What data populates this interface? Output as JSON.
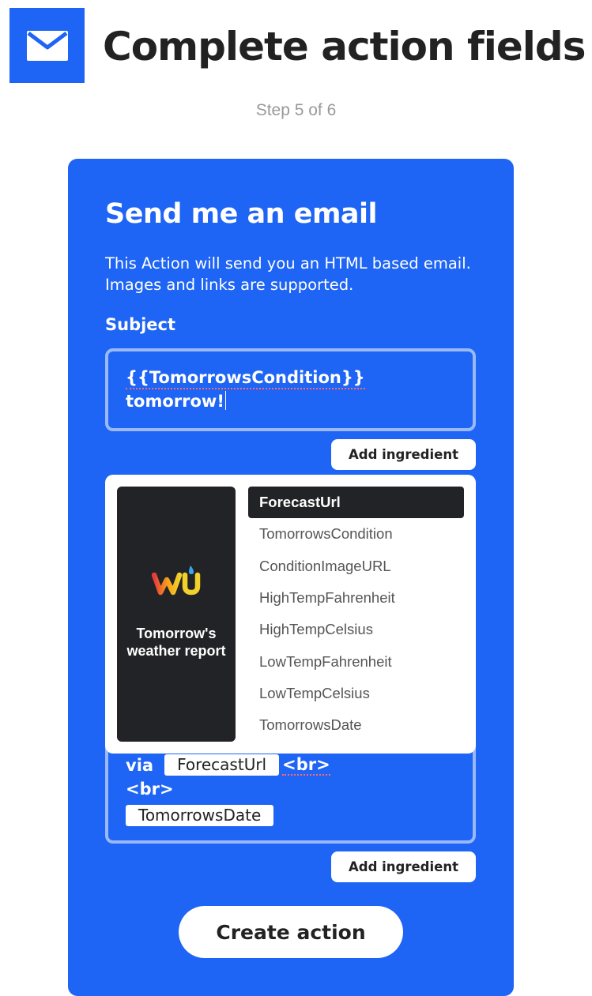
{
  "header": {
    "title": "Complete action fields",
    "icon": "mail-icon",
    "step": "Step 5 of 6"
  },
  "action": {
    "title": "Send me an email",
    "description": "This Action will send you an HTML based email. Images and links are supported.",
    "subject": {
      "label": "Subject",
      "value_line1": "{{TomorrowsCondition}}",
      "value_line2": "tomorrow!"
    },
    "add_ingredient_label": "Add ingredient",
    "ingredient_service": {
      "name": "Tomorrow's weather report",
      "logo": "wu-logo"
    },
    "ingredients": [
      "ForecastUrl",
      "TomorrowsCondition",
      "ConditionImageURL",
      "HighTempFahrenheit",
      "HighTempCelsius",
      "LowTempFahrenheit",
      "LowTempCelsius",
      "TomorrowsDate"
    ],
    "selected_ingredient": "ForecastUrl",
    "body": {
      "via_text": "via",
      "ingredient_1": "ForecastUrl",
      "br_tag_1": "<br>",
      "br_tag_2": "<br>",
      "ingredient_2": "TomorrowsDate"
    },
    "create_label": "Create action"
  },
  "colors": {
    "brand_blue": "#1e64f5",
    "dark_panel": "#222326",
    "white": "#ffffff"
  }
}
